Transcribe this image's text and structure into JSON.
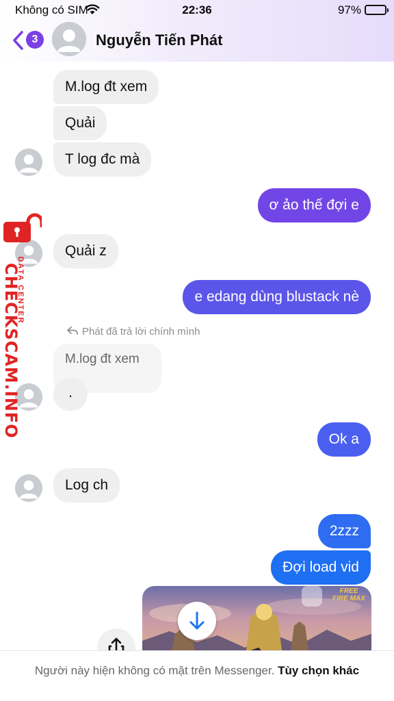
{
  "status_bar": {
    "carrier": "Không có SIM",
    "time": "22:36",
    "battery": "97%"
  },
  "header": {
    "back_badge": "3",
    "contact_name": "Nguyễn Tiến Phát"
  },
  "messages": [
    {
      "text": "M.log đt xem",
      "direction": "incoming"
    },
    {
      "text": "Quải",
      "direction": "incoming"
    },
    {
      "text": "T log đc mà",
      "direction": "incoming"
    },
    {
      "text": "ơ ảo thế đợi e",
      "direction": "outgoing"
    },
    {
      "text": "Quải z",
      "direction": "incoming"
    },
    {
      "text": "e edang dùng blustack nè",
      "direction": "outgoing"
    },
    {
      "text": ".",
      "direction": "incoming"
    },
    {
      "text": "Ok a",
      "direction": "outgoing"
    },
    {
      "text": "Log ch",
      "direction": "incoming"
    },
    {
      "text": "2zzz",
      "direction": "outgoing"
    },
    {
      "text": "Đợi load vid",
      "direction": "outgoing"
    }
  ],
  "reply": {
    "note": "Phát đã trả lời chính mình",
    "quoted_text": "M.log đt xem"
  },
  "video": {
    "game_logo": "FREE FIRE MAX"
  },
  "footer": {
    "notice": "Người này hiện không có mặt trên Messenger.",
    "link": "Tùy chọn khác"
  },
  "watermark": {
    "main": "CHECKSCAM.INFO",
    "sub": "DATA CENTER"
  },
  "colors": {
    "accent_purple": "#7b3fe4",
    "bubble_out_top": "#7646e8",
    "bubble_out_bottom": "#1f6ff2",
    "bubble_in": "#efefef"
  }
}
